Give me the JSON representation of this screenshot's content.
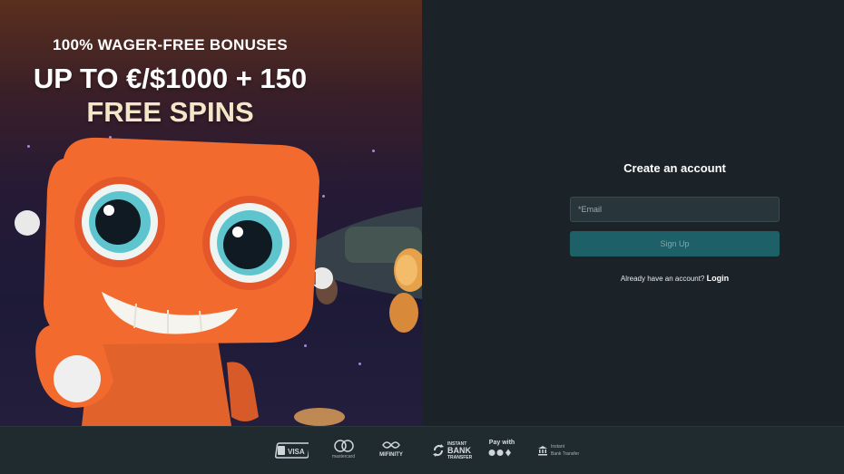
{
  "promo": {
    "subheadline": "100% WAGER-FREE BONUSES",
    "headline_line1": "UP TO €/$1000 + 150",
    "headline_line2": "FREE SPINS"
  },
  "form": {
    "title": "Create an account",
    "email_placeholder": "*Email",
    "signup_label": "Sign Up",
    "already_text": "Already have an account?",
    "login_label": "Login"
  },
  "footer": {
    "payment_methods": [
      {
        "name": "VISA",
        "icon": "visa-icon"
      },
      {
        "name": "mastercard",
        "icon": "mastercard-icon"
      },
      {
        "name": "MIFINITY",
        "icon": "mifinity-icon"
      },
      {
        "name_line1": "INSTANT",
        "name_line2": "BANK",
        "name_line3": "TRANSFER",
        "icon": "instant-bank-transfer-icon"
      },
      {
        "name": "Pay with",
        "icon": "crypto-icon"
      },
      {
        "name_line1": "Instant",
        "name_line2": "Bank Transfer",
        "icon": "bank-icon"
      }
    ]
  },
  "colors": {
    "panel_bg": "#1b2328",
    "input_bg": "#28363c",
    "button_bg": "#1e6068",
    "robot_orange": "#f26a2e"
  }
}
